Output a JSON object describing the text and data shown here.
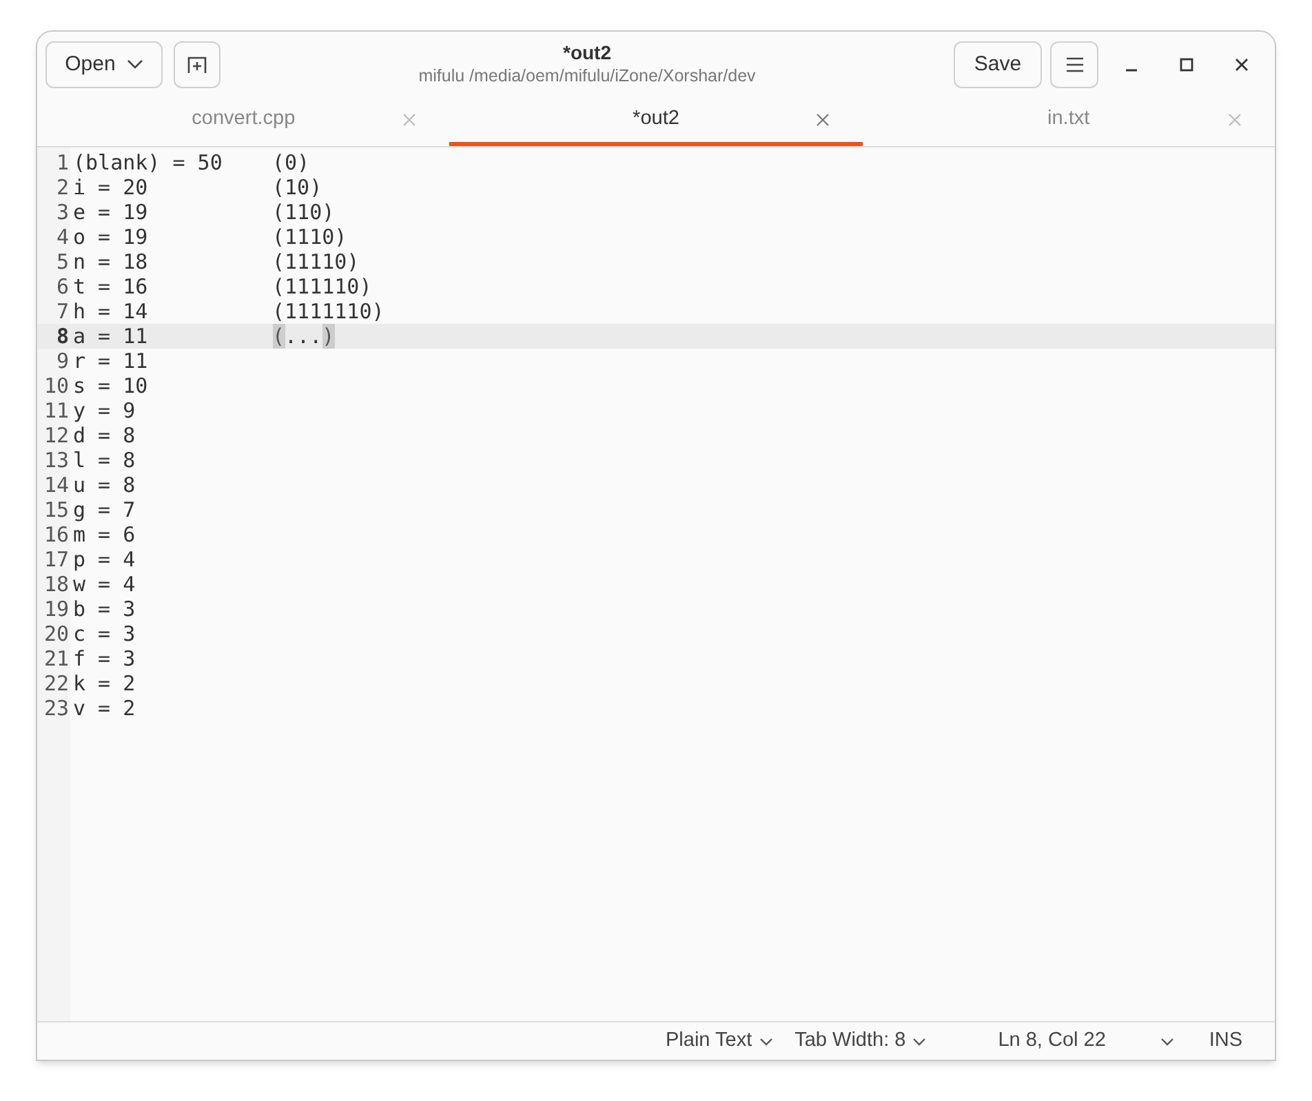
{
  "header": {
    "open_button": "Open",
    "title": "*out2",
    "subtitle": "mifulu /media/oem/mifulu/iZone/Xorshar/dev",
    "save_button": "Save"
  },
  "tabs": [
    {
      "label": "convert.cpp",
      "selected": false
    },
    {
      "label": "*out2",
      "selected": true
    },
    {
      "label": "in.txt",
      "selected": false
    }
  ],
  "lines": [
    {
      "number": "1",
      "text": "(blank) = 50\t(0)",
      "current": false
    },
    {
      "number": "2",
      "text": "i = 20\t\t(10)",
      "current": false
    },
    {
      "number": "3",
      "text": "e = 19\t\t(110)",
      "current": false
    },
    {
      "number": "4",
      "text": "o = 19\t\t(1110)",
      "current": false
    },
    {
      "number": "5",
      "text": "n = 18\t\t(11110)",
      "current": false
    },
    {
      "number": "6",
      "text": "t = 16\t\t(111110)",
      "current": false
    },
    {
      "number": "7",
      "text": "h = 14\t\t(1111110)",
      "current": false
    },
    {
      "number": "8",
      "current": true,
      "segments": [
        {
          "text": "a = 11\t\t",
          "bracket_match": false
        },
        {
          "text": "(",
          "bracket_match": true
        },
        {
          "text": "...",
          "bracket_match": false
        },
        {
          "text": ")",
          "bracket_match": true
        }
      ]
    },
    {
      "number": "9",
      "text": "r = 11",
      "current": false
    },
    {
      "number": "10",
      "text": "s = 10",
      "current": false
    },
    {
      "number": "11",
      "text": "y = 9",
      "current": false
    },
    {
      "number": "12",
      "text": "d = 8",
      "current": false
    },
    {
      "number": "13",
      "text": "l = 8",
      "current": false
    },
    {
      "number": "14",
      "text": "u = 8",
      "current": false
    },
    {
      "number": "15",
      "text": "g = 7",
      "current": false
    },
    {
      "number": "16",
      "text": "m = 6",
      "current": false
    },
    {
      "number": "17",
      "text": "p = 4",
      "current": false
    },
    {
      "number": "18",
      "text": "w = 4",
      "current": false
    },
    {
      "number": "19",
      "text": "b = 3",
      "current": false
    },
    {
      "number": "20",
      "text": "c = 3",
      "current": false
    },
    {
      "number": "21",
      "text": "f = 3",
      "current": false
    },
    {
      "number": "22",
      "text": "k = 2",
      "current": false
    },
    {
      "number": "23",
      "text": "v = 2",
      "current": false
    }
  ],
  "status_bar": {
    "language": "Plain Text",
    "tab_width": "Tab Width: 8",
    "position": "Ln 8, Col 22",
    "mode": "INS"
  }
}
